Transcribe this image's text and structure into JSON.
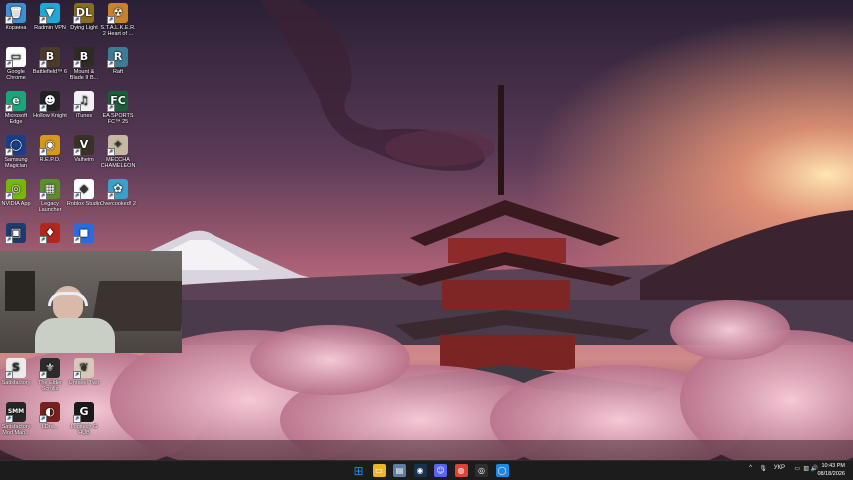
{
  "desktop_icons": [
    {
      "label": "Корзина",
      "icon": "recycle-bin-icon",
      "color": "#3d8fd6",
      "glyph": "🗑"
    },
    {
      "label": "Radmin VPN",
      "icon": "radmin-vpn-icon",
      "color": "#1fa9d6",
      "glyph": "▼"
    },
    {
      "label": "Dying Light",
      "icon": "dying-light-icon",
      "color": "#8a6d1d",
      "glyph": "DL"
    },
    {
      "label": "S.T.A.L.K.E.R. 2 Heart of ...",
      "icon": "stalker-icon",
      "color": "#c9822b",
      "glyph": "☢"
    },
    {
      "label": "Google Chrome",
      "icon": "google-chrome-icon",
      "color": "#ffffff",
      "glyph": "▭"
    },
    {
      "label": "Battlefield™ 6",
      "icon": "battlefield-icon",
      "color": "#4c3b2b",
      "glyph": "B"
    },
    {
      "label": "Mount & Blade II B...",
      "icon": "mount-blade-icon",
      "color": "#2e2a24",
      "glyph": "B"
    },
    {
      "label": "Raft",
      "icon": "raft-icon",
      "color": "#3a7c95",
      "glyph": "R"
    },
    {
      "label": "Microsoft Edge",
      "icon": "edge-icon",
      "color": "#1ba57b",
      "glyph": "e"
    },
    {
      "label": "Hollow Knight",
      "icon": "hollow-knight-icon",
      "color": "#222222",
      "glyph": "☻"
    },
    {
      "label": "iTunes",
      "icon": "itunes-icon",
      "color": "#f2f2f2",
      "glyph": "♫"
    },
    {
      "label": "EA SPORTS FC™ 25",
      "icon": "ea-fc-icon",
      "color": "#1b5e3a",
      "glyph": "FC"
    },
    {
      "label": "Samsung Magician",
      "icon": "samsung-magician-icon",
      "color": "#173f8c",
      "glyph": "◯"
    },
    {
      "label": "R.E.P.O.",
      "icon": "repo-icon",
      "color": "#d69a1a",
      "glyph": "◉"
    },
    {
      "label": "Valheim",
      "icon": "valheim-icon",
      "color": "#3a3229",
      "glyph": "V"
    },
    {
      "label": "MECCHA CHAMELEON",
      "icon": "meccha-chameleon-icon",
      "color": "#c5b9a2",
      "glyph": "✦"
    },
    {
      "label": "NVIDIA App",
      "icon": "nvidia-icon",
      "color": "#76b900",
      "glyph": "◎"
    },
    {
      "label": "Legacy Launcher",
      "icon": "legacy-launcher-icon",
      "color": "#5a8f2a",
      "glyph": "▦"
    },
    {
      "label": "Roblox Studio",
      "icon": "roblox-studio-icon",
      "color": "#ffffff",
      "glyph": "◆"
    },
    {
      "label": "Overcooked! 2",
      "icon": "overcooked-icon",
      "color": "#3aa0c9",
      "glyph": "✿"
    },
    {
      "label": "",
      "icon": "monitor-app-icon",
      "color": "#1f3a6e",
      "glyph": "▣"
    },
    {
      "label": "",
      "icon": "shield-game-icon",
      "color": "#b3261e",
      "glyph": "♦"
    },
    {
      "label": "",
      "icon": "roblox-icon",
      "color": "#2a6be0",
      "glyph": "◼"
    },
    {
      "label": "Satisfactory",
      "icon": "satisfactory-icon",
      "color": "#ececec",
      "glyph": "S"
    },
    {
      "label": "The Elder Scrolls",
      "icon": "elder-scrolls-icon",
      "color": "#2b2b2b",
      "glyph": "⚜"
    },
    {
      "label": "Unravel Two",
      "icon": "unravel-two-icon",
      "color": "#d8c8b8",
      "glyph": "❦"
    },
    {
      "label": "Satisfactory Mod Man...",
      "icon": "smm-icon",
      "color": "#262626",
      "glyph": "SMM"
    },
    {
      "label": "LDra...",
      "icon": "ldra-icon",
      "color": "#7a1f1f",
      "glyph": "◐"
    },
    {
      "label": "Logitech G HUB",
      "icon": "logitech-ghub-icon",
      "color": "#1a1a1a",
      "glyph": "G"
    }
  ],
  "taskbar": {
    "apps": [
      {
        "name": "start-button",
        "icon": "windows-icon",
        "color": "#1e88e5",
        "glyph": "⊞"
      },
      {
        "name": "file-explorer-button",
        "icon": "folder-icon",
        "color": "#f0b429",
        "glyph": "▭"
      },
      {
        "name": "notepad-button",
        "icon": "notepad-icon",
        "color": "#5f7ea3",
        "glyph": "▤"
      },
      {
        "name": "steam-button",
        "icon": "steam-icon",
        "color": "#17324d",
        "glyph": "◉"
      },
      {
        "name": "discord-button",
        "icon": "discord-icon",
        "color": "#5865f2",
        "glyph": "☺"
      },
      {
        "name": "chrome-button",
        "icon": "chrome-icon",
        "color": "#db4437",
        "glyph": "◍"
      },
      {
        "name": "obs-button",
        "icon": "obs-icon",
        "color": "#302e31",
        "glyph": "◎"
      },
      {
        "name": "browser-badge-button",
        "icon": "globe-icon",
        "color": "#1e88e5",
        "glyph": "◯"
      }
    ],
    "tray": {
      "chevron": "^",
      "language": "УКР"
    },
    "clock": {
      "time": "10:43 PM",
      "date": "08/18/2026"
    }
  }
}
